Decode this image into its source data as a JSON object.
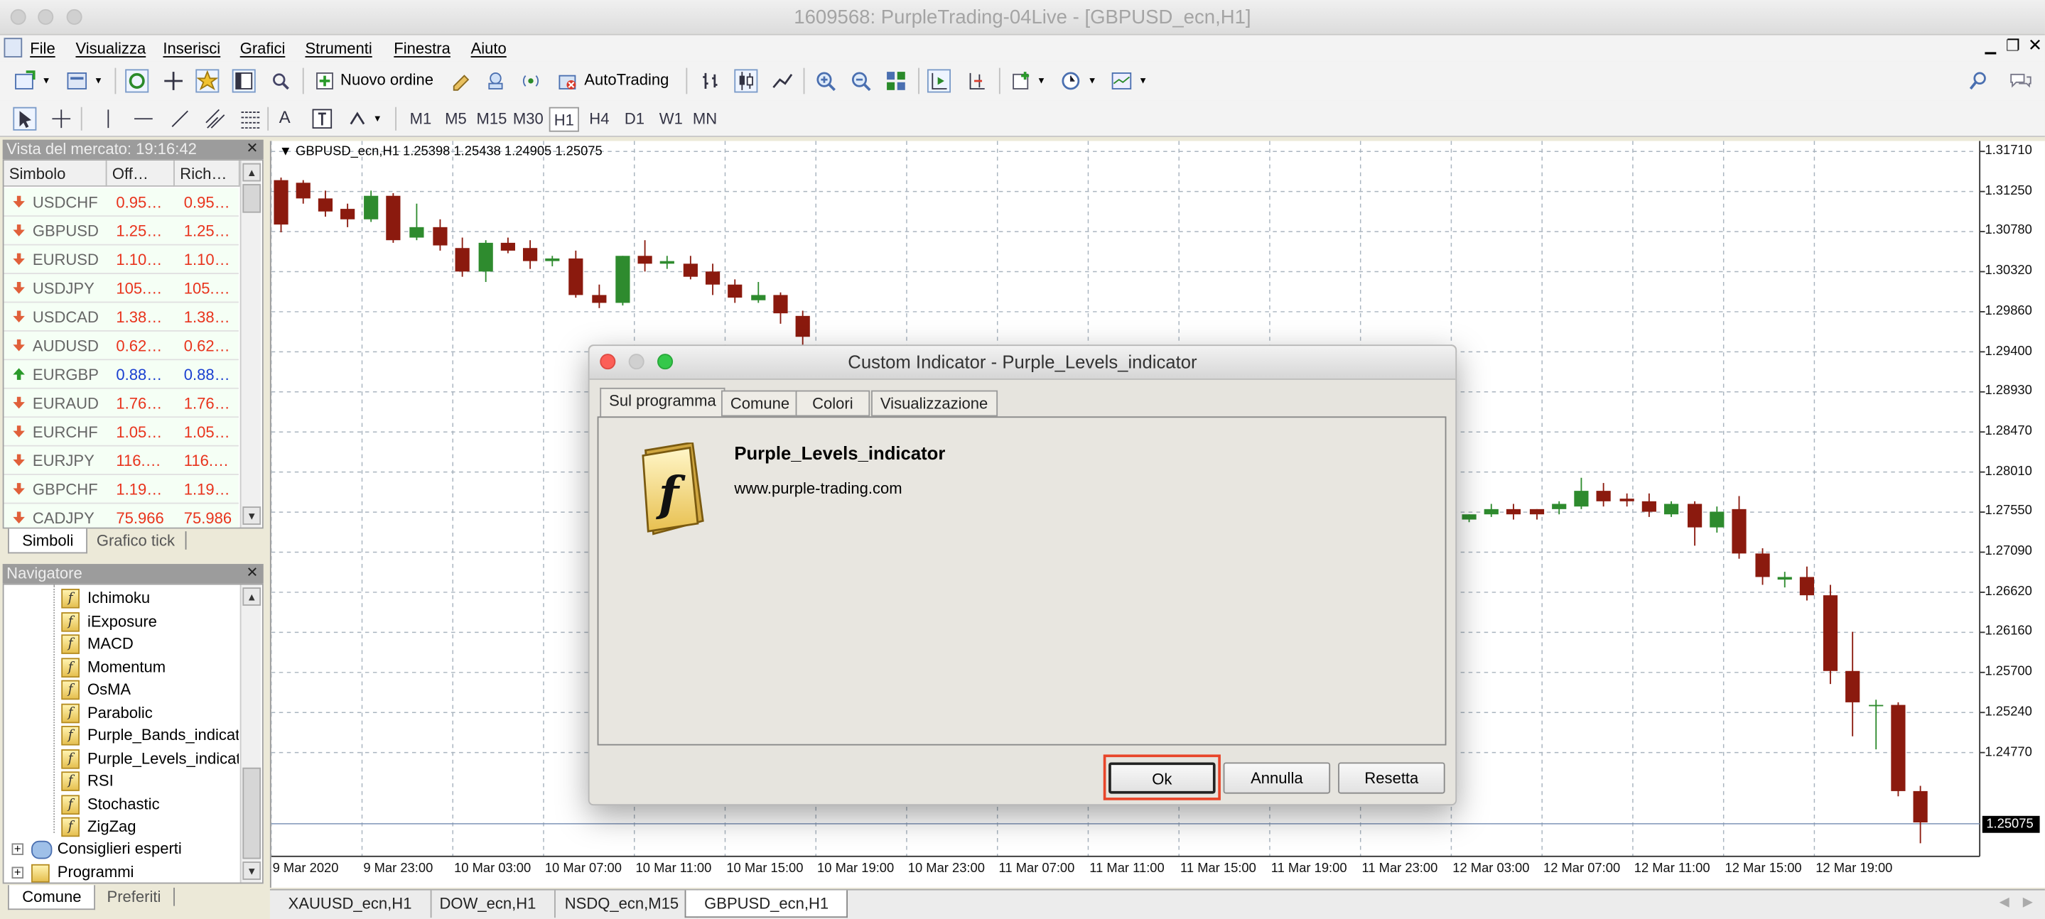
{
  "window": {
    "title": "1609568: PurpleTrading-04Live - [GBPUSD_ecn,H1]"
  },
  "menu": [
    "File",
    "Visualizza",
    "Inserisci",
    "Grafici",
    "Strumenti",
    "Finestra",
    "Aiuto"
  ],
  "toolbar": {
    "new_order": "Nuovo ordine",
    "autotrading": "AutoTrading",
    "timeframes": [
      "M1",
      "M5",
      "M15",
      "M30",
      "H1",
      "H4",
      "D1",
      "W1",
      "MN"
    ],
    "active_timeframe": "H1"
  },
  "market_watch": {
    "title": "Vista del mercato: 19:16:42",
    "columns": [
      "Simbolo",
      "Off…",
      "Rich…"
    ],
    "rows": [
      {
        "symbol": "USDCHF",
        "bid": "0.95…",
        "ask": "0.95…",
        "dir": "down"
      },
      {
        "symbol": "GBPUSD",
        "bid": "1.25…",
        "ask": "1.25…",
        "dir": "down"
      },
      {
        "symbol": "EURUSD",
        "bid": "1.10…",
        "ask": "1.10…",
        "dir": "down"
      },
      {
        "symbol": "USDJPY",
        "bid": "105.…",
        "ask": "105.…",
        "dir": "down"
      },
      {
        "symbol": "USDCAD",
        "bid": "1.38…",
        "ask": "1.38…",
        "dir": "down"
      },
      {
        "symbol": "AUDUSD",
        "bid": "0.62…",
        "ask": "0.62…",
        "dir": "down"
      },
      {
        "symbol": "EURGBP",
        "bid": "0.88…",
        "ask": "0.88…",
        "dir": "up"
      },
      {
        "symbol": "EURAUD",
        "bid": "1.76…",
        "ask": "1.76…",
        "dir": "down"
      },
      {
        "symbol": "EURCHF",
        "bid": "1.05…",
        "ask": "1.05…",
        "dir": "down"
      },
      {
        "symbol": "EURJPY",
        "bid": "116.…",
        "ask": "116.…",
        "dir": "down"
      },
      {
        "symbol": "GBPCHF",
        "bid": "1.19…",
        "ask": "1.19…",
        "dir": "down"
      },
      {
        "symbol": "CADJPY",
        "bid": "75.966",
        "ask": "75.986",
        "dir": "down"
      }
    ],
    "tabs": [
      "Simboli",
      "Grafico tick"
    ]
  },
  "navigator": {
    "title": "Navigatore",
    "items": [
      "Ichimoku",
      "iExposure",
      "MACD",
      "Momentum",
      "OsMA",
      "Parabolic",
      "Purple_Bands_indicato",
      "Purple_Levels_indicato",
      "RSI",
      "Stochastic",
      "ZigZag"
    ],
    "groups": [
      "Consiglieri esperti",
      "Programmi"
    ],
    "tabs": [
      "Comune",
      "Preferiti"
    ]
  },
  "chart": {
    "header": "GBPUSD_ecn,H1  1.25398 1.25438 1.24905 1.25075",
    "yticks": [
      "1.31710",
      "1.31250",
      "1.30780",
      "1.30320",
      "1.29860",
      "1.29400",
      "1.28930",
      "1.28470",
      "1.28010",
      "1.27550",
      "1.27090",
      "1.26620",
      "1.26160",
      "1.25700",
      "1.25240",
      "1.24770"
    ],
    "xticks": [
      "9 Mar 2020",
      "9 Mar 23:00",
      "10 Mar 03:00",
      "10 Mar 07:00",
      "10 Mar 11:00",
      "10 Mar 15:00",
      "10 Mar 19:00",
      "10 Mar 23:00",
      "11 Mar 07:00",
      "11 Mar 11:00",
      "11 Mar 15:00",
      "11 Mar 19:00",
      "11 Mar 23:00",
      "12 Mar 03:00",
      "12 Mar 07:00",
      "12 Mar 11:00",
      "12 Mar 15:00",
      "12 Mar 19:00"
    ],
    "current_price": "1.25075",
    "tabs": [
      "XAUUSD_ecn,H1",
      "DOW_ecn,H1",
      "NSDQ_ecn,M15",
      "GBPUSD_ecn,H1"
    ],
    "active_tab": "GBPUSD_ecn,H1",
    "colors": {
      "bull": "#2e8b2e",
      "bear": "#8b1a0e"
    }
  },
  "dialog": {
    "title": "Custom Indicator - Purple_Levels_indicator",
    "tabs": [
      "Sul programma",
      "Comune",
      "Colori",
      "Visualizzazione"
    ],
    "indicator_name": "Purple_Levels_indicator",
    "website": "www.purple-trading.com",
    "buttons": {
      "ok": "Ok",
      "cancel": "Annulla",
      "reset": "Resetta"
    }
  }
}
